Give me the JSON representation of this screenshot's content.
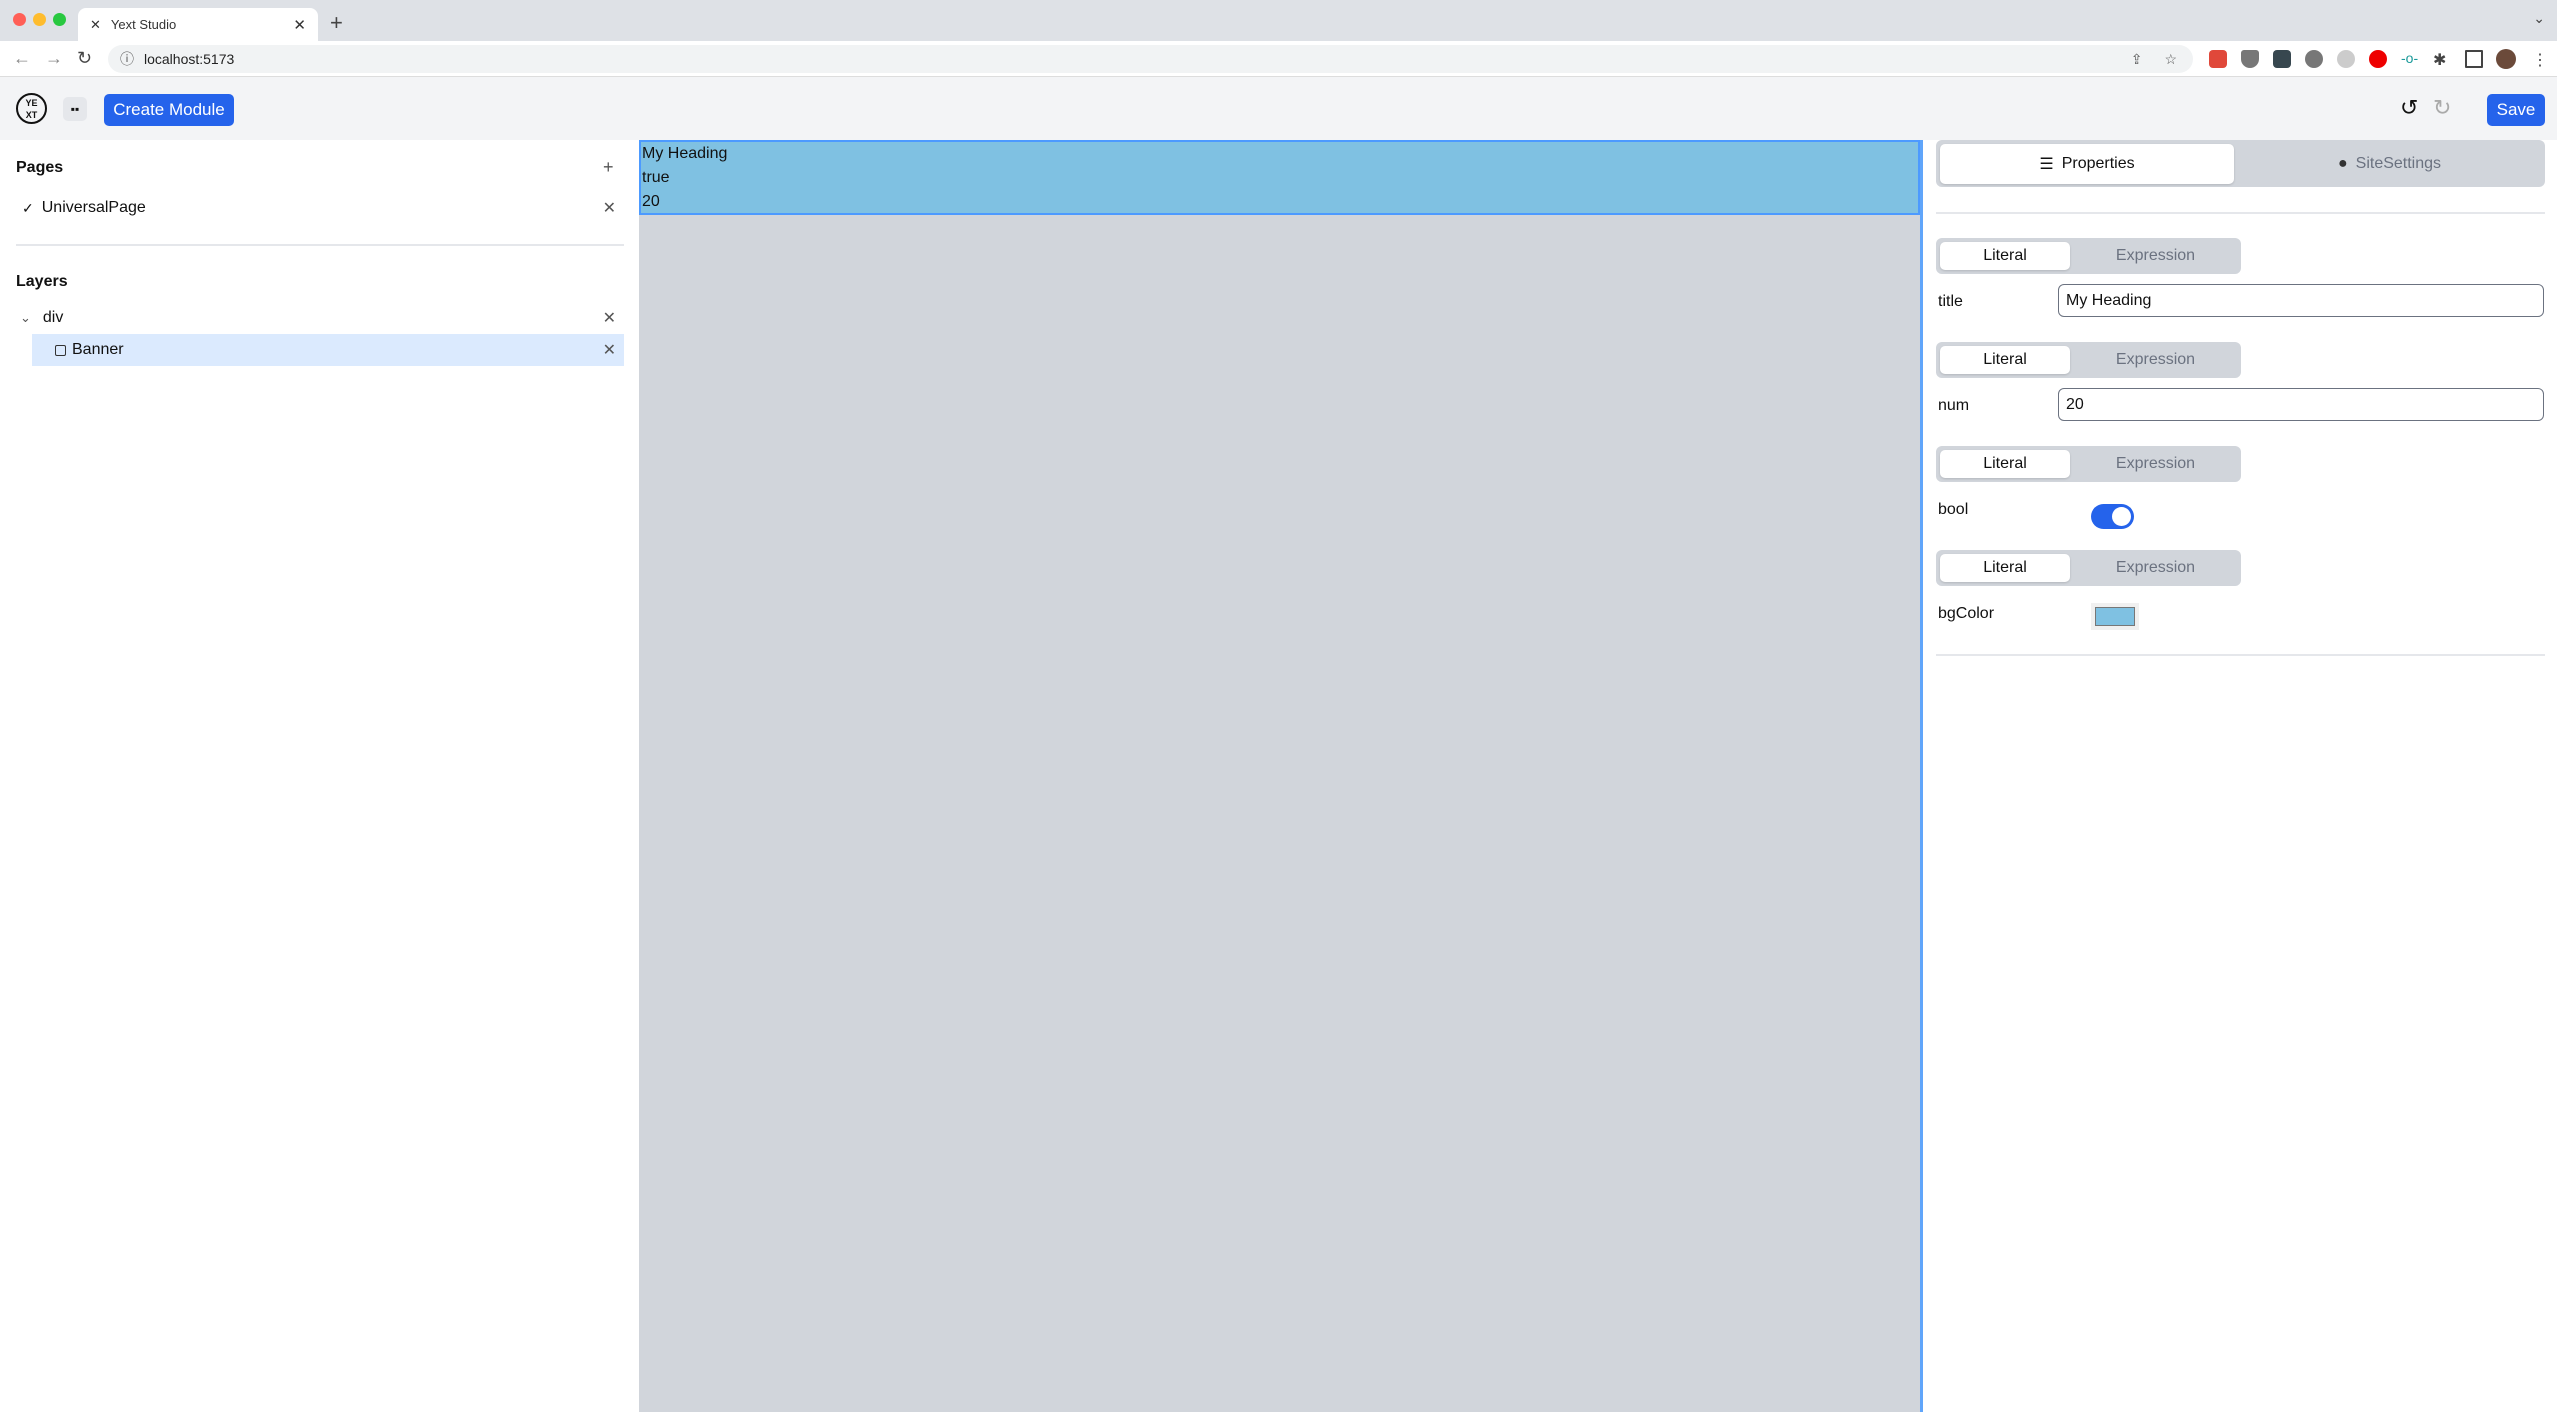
{
  "browser": {
    "tab_title": "Yext Studio",
    "url": "localhost:5173"
  },
  "header": {
    "create_module": "Create Module",
    "save": "Save",
    "logo_text": "YEXT"
  },
  "left": {
    "pages_title": "Pages",
    "pages": [
      {
        "label": "UniversalPage"
      }
    ],
    "layers_title": "Layers",
    "layers": [
      {
        "label": "div"
      },
      {
        "label": "Banner"
      }
    ]
  },
  "canvas": {
    "lines": [
      "My Heading",
      "true",
      "20"
    ],
    "banner_color": "#7fc1e2"
  },
  "right": {
    "tabs": [
      {
        "label": "Properties"
      },
      {
        "label": "SiteSettings"
      }
    ],
    "props": [
      {
        "name": "title",
        "mode_on": "Literal",
        "mode_off": "Expression",
        "value": "My Heading"
      },
      {
        "name": "num",
        "mode_on": "Literal",
        "mode_off": "Expression",
        "value": "20"
      },
      {
        "name": "bool",
        "mode_on": "Literal",
        "mode_off": "Expression",
        "value": true
      },
      {
        "name": "bgColor",
        "mode_on": "Literal",
        "mode_off": "Expression",
        "value": "#7fc1e2"
      }
    ]
  },
  "accent": "#2563eb"
}
